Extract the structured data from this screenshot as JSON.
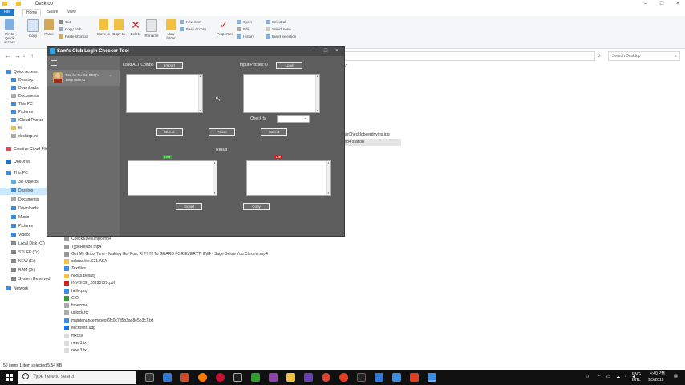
{
  "explorer": {
    "title": "Desktop",
    "tabs": [
      "File",
      "Home",
      "Share",
      "View"
    ],
    "ribbon_buttons": [
      "Pin to Quick access",
      "Copy",
      "Paste",
      "Move to",
      "Copy to",
      "Delete",
      "Rename",
      "New folder",
      "Properties"
    ],
    "ribbon_small": [
      "Cut",
      "Copy path",
      "Paste shortcut",
      "New item",
      "Easy access",
      "Open",
      "Edit",
      "History",
      "Select all",
      "Select none",
      "Invert selection"
    ],
    "search_placeholder": "Search Desktop",
    "nav_items": [
      "Quick access",
      "Desktop",
      "Downloads",
      "Documents",
      "This PC",
      "Pictures",
      "iCloud Photos",
      "fil",
      "Creative Cloud Files",
      "OneDrive",
      "This PC",
      "3D Objects",
      "Desktop",
      "Documents",
      "Downloads",
      "Music",
      "Pictures",
      "Videos",
      "Local Disk (C:)",
      "STUFF (D:)",
      "NEW (E:)",
      "RAM (G:)",
      "System Reserved",
      "Network"
    ],
    "files": [
      "Check&Dellumpo.mp4",
      "TypeResize.mp4",
      "Get My Grips Time - Making Go! Fun, R!!!!!!!!!! To GUARD FOR EVERYTHING - Sage Below You Chrome.mp4",
      "cobras.lite.S21.ASA",
      "Textfiles",
      "hooks Beauty",
      "INVOICE_20190725.pdf",
      "hello.png",
      "CIO",
      "timezone",
      "unlock.rtc",
      "maintenance.mjpeg 6fc0c7d5b3ad8e5b3c7.txt",
      "Microsoft.udp",
      "mxcsv",
      "new 3.txt",
      "new 3.txt"
    ],
    "right_files": [
      "nixCheckIdbeerdriving.jpg",
      "mp4 station"
    ],
    "status": "50 items    1 item selected  5.54 KB"
  },
  "taskbar": {
    "search_placeholder": "Type here to search",
    "lang": "ENG",
    "locale": "INTL",
    "time": "4:40 PM",
    "date": "9/5/2019"
  },
  "app": {
    "title": "Sam's Club Login Checker Tool",
    "profile_line1": "Tool by Fu GB BBQ's",
    "profile_line2": "1468754870",
    "pin_glyph": "✧",
    "combos_label": "Load ALT Combo",
    "import_label": "Import",
    "proxies_label": "Input Proxies: 0",
    "load_label": "Load",
    "threads_label": "Check fa",
    "check_label": "Check",
    "pause_label": "Pause",
    "stop_label": "Collect",
    "result_label": "Result",
    "live_tag": "Live",
    "die_tag": "Die",
    "export_label": "Export",
    "copy_label": "Copy"
  },
  "colors": {
    "live": "#2da02d",
    "die": "#d82020",
    "file_tab": "#1979ca",
    "taskbar": "#101010"
  }
}
